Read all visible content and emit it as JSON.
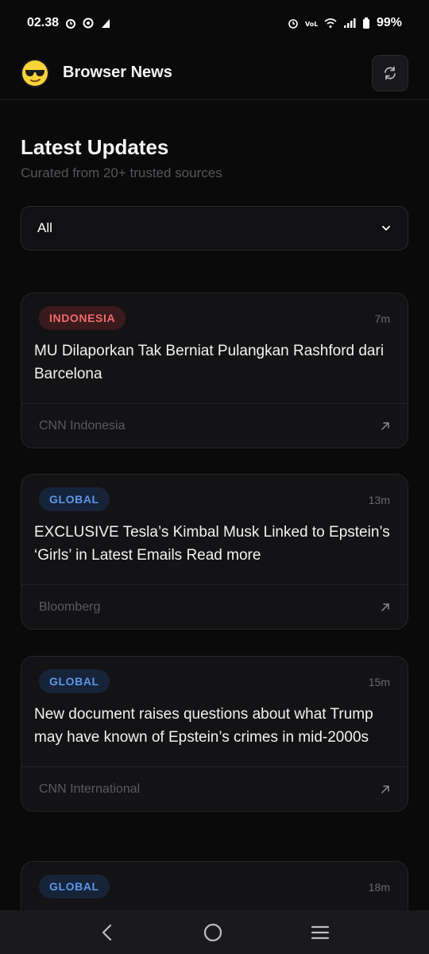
{
  "status_bar": {
    "time": "02.38",
    "battery": "99%",
    "left_icons": [
      "alarm-icon",
      "vpn-icon",
      "data-activity-icon"
    ],
    "right_icons": [
      "alarm-icon",
      "volte-icon",
      "wifi-icon",
      "signal-icon",
      "battery-icon"
    ]
  },
  "header": {
    "title": "Browser News",
    "logo_icon": "sunglasses-emoji-icon",
    "refresh_icon": "refresh-icon"
  },
  "page": {
    "title": "Latest Updates",
    "subtitle": "Curated from 20+ trusted sources"
  },
  "filter": {
    "selected": "All",
    "icon": "chevron-down-icon"
  },
  "articles": [
    {
      "category": "INDONESIA",
      "time": "7m",
      "headline": "MU Dilaporkan Tak Berniat Pulangkan Rashford dari Barcelona",
      "source": "CNN Indonesia"
    },
    {
      "category": "GLOBAL",
      "time": "13m",
      "headline": "EXCLUSIVE Tesla’s Kimbal Musk Linked to Epstein’s ‘Girls’ in Latest Emails Read more",
      "source": "Bloomberg"
    },
    {
      "category": "GLOBAL",
      "time": "15m",
      "headline": "New document raises questions about what Trump may have known of Epstein’s crimes in mid-2000s",
      "source": "CNN International"
    },
    {
      "category": "GLOBAL",
      "time": "18m"
    }
  ],
  "colors": {
    "background": "#0a0a0a",
    "card": "#131315",
    "indonesia_badge": "#ef6b6b",
    "global_badge": "#5c97e6"
  },
  "nav": {
    "icons": [
      "back-icon",
      "home-icon",
      "recents-icon"
    ]
  }
}
